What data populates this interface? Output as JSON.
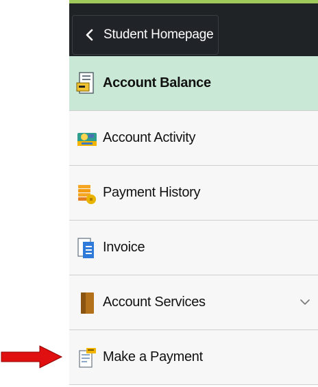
{
  "topbar": {
    "back_label": "Student Homepage"
  },
  "nav": {
    "items": [
      {
        "label": "Account Balance",
        "icon": "account-balance-icon",
        "active": true
      },
      {
        "label": "Account Activity",
        "icon": "account-activity-icon",
        "active": false
      },
      {
        "label": "Payment History",
        "icon": "payment-history-icon",
        "active": false
      },
      {
        "label": "Invoice",
        "icon": "invoice-icon",
        "active": false
      },
      {
        "label": "Account Services",
        "icon": "account-services-icon",
        "active": false,
        "expandable": true
      },
      {
        "label": "Make a Payment",
        "icon": "make-payment-icon",
        "active": false
      }
    ]
  },
  "annotation": {
    "pointer": "red-arrow-icon",
    "pointer_color": "#e01010"
  },
  "colors": {
    "topbar": "#1f2326",
    "topbar_accent": "#9fca5b",
    "active_item": "#c9e8d5",
    "item_background": "#f7f7f7",
    "divider": "#cfcfcf"
  }
}
